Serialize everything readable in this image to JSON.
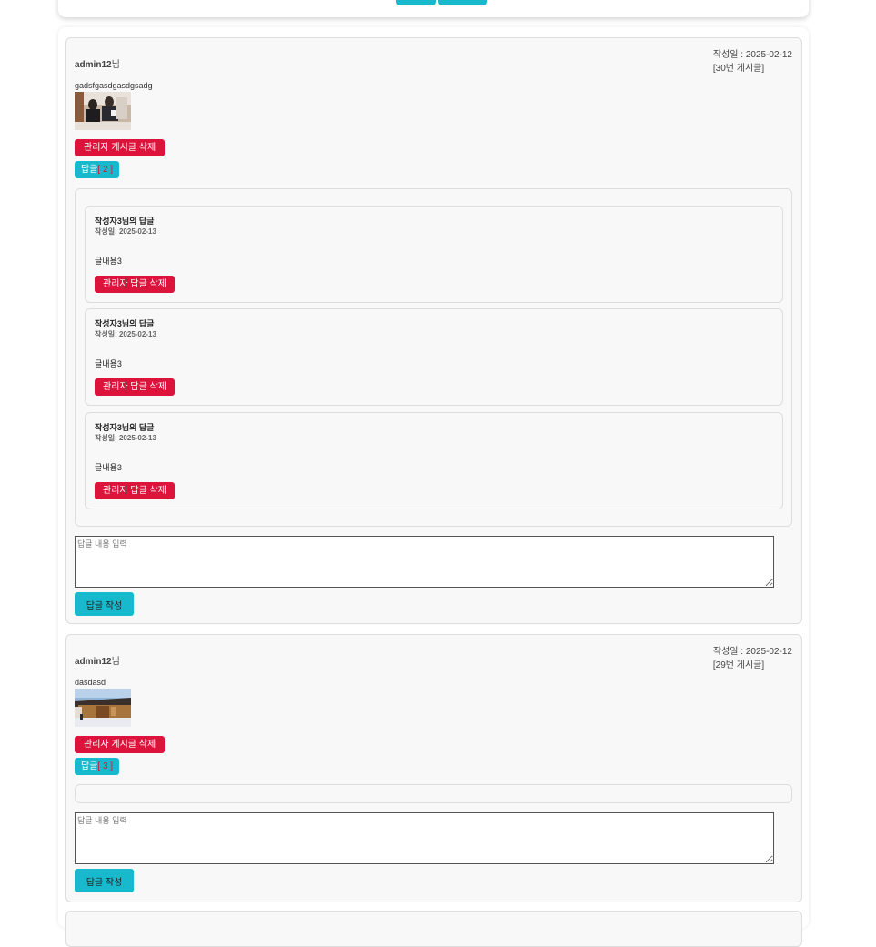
{
  "accent_color": "#17b9cc",
  "danger_color": "#dc143c",
  "posts": [
    {
      "author": "admin12",
      "author_suffix": "님",
      "date_line": "작성일 : 2025-02-12",
      "post_number": "[30번 게시글]",
      "content": "gadsfgasdgasdgsadg",
      "image": "meeting-photo",
      "delete_label": "관리자 게시글 삭제",
      "reply_toggle_label": "답글",
      "reply_count": "[ 2 ]",
      "replies": [
        {
          "title": "작성자3님의 답글",
          "date": "작성일: 2025-02-13",
          "content": "글내용3",
          "delete_label": "관리자 답글 삭제"
        },
        {
          "title": "작성자3님의 답글",
          "date": "작성일: 2025-02-13",
          "content": "글내용3",
          "delete_label": "관리자 답글 삭제"
        },
        {
          "title": "작성자3님의 답글",
          "date": "작성일: 2025-02-13",
          "content": "글내용3",
          "delete_label": "관리자 답글 삭제"
        }
      ],
      "reply_placeholder": "답글 내용 입력",
      "submit_label": "답글 작성"
    },
    {
      "author": "admin12",
      "author_suffix": "님",
      "date_line": "작성일 : 2025-02-12",
      "post_number": "[29번 게시글]",
      "content": "dasdasd",
      "image": "hanok-photo",
      "delete_label": "관리자 게시글 삭제",
      "reply_toggle_label": "답글",
      "reply_count": "[ 3 ]",
      "replies": [],
      "reply_placeholder": "답글 내용 입력",
      "submit_label": "답글 작성"
    }
  ]
}
